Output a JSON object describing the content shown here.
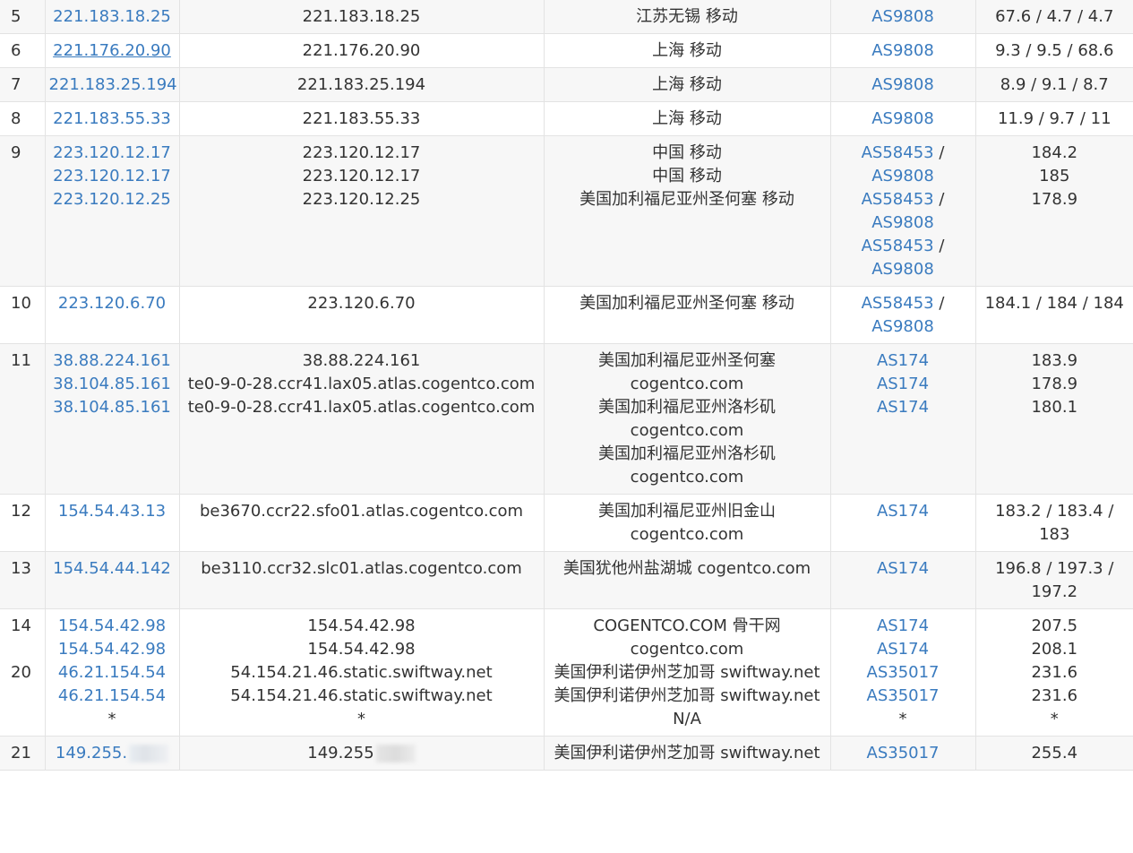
{
  "rows": [
    {
      "hop": "5",
      "ips": [
        "221.183.18.25"
      ],
      "hosts": [
        "221.183.18.25"
      ],
      "locs": [
        "江苏无锡 移动"
      ],
      "as": [
        [
          "AS9808"
        ]
      ],
      "rtt": [
        "67.6 / 4.7 / 4.7"
      ]
    },
    {
      "hop": "6",
      "ips": [
        "221.176.20.90"
      ],
      "hosts": [
        "221.176.20.90"
      ],
      "locs": [
        "上海 移动"
      ],
      "as": [
        [
          "AS9808"
        ]
      ],
      "rtt": [
        "9.3 / 9.5 / 68.6"
      ]
    },
    {
      "hop": "7",
      "ips": [
        "221.183.25.194"
      ],
      "hosts": [
        "221.183.25.194"
      ],
      "locs": [
        "上海 移动"
      ],
      "as": [
        [
          "AS9808"
        ]
      ],
      "rtt": [
        "8.9 / 9.1 / 8.7"
      ]
    },
    {
      "hop": "8",
      "ips": [
        "221.183.55.33"
      ],
      "hosts": [
        "221.183.55.33"
      ],
      "locs": [
        "上海 移动"
      ],
      "as": [
        [
          "AS9808"
        ]
      ],
      "rtt": [
        "11.9 / 9.7 / 11"
      ]
    },
    {
      "hop": "9",
      "ips": [
        "223.120.12.17",
        "223.120.12.17",
        "223.120.12.25"
      ],
      "hosts": [
        "223.120.12.17",
        "223.120.12.17",
        "223.120.12.25"
      ],
      "locs": [
        "中国 移动",
        "中国 移动",
        "美国加利福尼亚州圣何塞 移动"
      ],
      "as": [
        [
          "AS58453",
          "AS9808"
        ],
        [
          "AS58453",
          "AS9808"
        ],
        [
          "AS58453",
          "AS9808"
        ]
      ],
      "rtt": [
        "184.2",
        "185",
        "178.9"
      ]
    },
    {
      "hop": "10",
      "ips": [
        "223.120.6.70"
      ],
      "hosts": [
        "223.120.6.70"
      ],
      "locs": [
        "美国加利福尼亚州圣何塞 移动"
      ],
      "as": [
        [
          "AS58453",
          "AS9808"
        ]
      ],
      "rtt": [
        "184.1 / 184 / 184"
      ]
    },
    {
      "hop": "11",
      "ips": [
        "38.88.224.161",
        "38.104.85.161",
        "38.104.85.161"
      ],
      "hosts": [
        "38.88.224.161",
        "te0-9-0-28.ccr41.lax05.atlas.cogentco.com",
        "te0-9-0-28.ccr41.lax05.atlas.cogentco.com"
      ],
      "locs": [
        "美国加利福尼亚州圣何塞",
        "cogentco.com",
        "美国加利福尼亚州洛杉矶",
        "cogentco.com",
        "美国加利福尼亚州洛杉矶",
        "cogentco.com"
      ],
      "as": [
        [
          "AS174"
        ],
        [
          "AS174"
        ],
        [
          "AS174"
        ]
      ],
      "rtt": [
        "183.9",
        "178.9",
        "180.1"
      ]
    },
    {
      "hop": "12",
      "ips": [
        "154.54.43.13"
      ],
      "hosts": [
        "be3670.ccr22.sfo01.atlas.cogentco.com"
      ],
      "locs": [
        "美国加利福尼亚州旧金山",
        "cogentco.com"
      ],
      "as": [
        [
          "AS174"
        ]
      ],
      "rtt": [
        "183.2 / 183.4 /",
        "183"
      ]
    },
    {
      "hop": "13",
      "ips": [
        "154.54.44.142"
      ],
      "hosts": [
        "be3110.ccr32.slc01.atlas.cogentco.com"
      ],
      "locs": [
        "美国犹他州盐湖城 cogentco.com"
      ],
      "as": [
        [
          "AS174"
        ]
      ],
      "rtt": [
        "196.8 / 197.3 /",
        "197.2"
      ]
    },
    {
      "hop": "14",
      "ips": [
        "154.54.42.98",
        "154.54.42.98"
      ],
      "hosts": [
        "154.54.42.98",
        "154.54.42.98"
      ],
      "locs": [
        "COGENTCO.COM 骨干网",
        "cogentco.com"
      ],
      "as": [
        [
          "AS174"
        ],
        [
          "AS174"
        ]
      ],
      "rtt": [
        "207.5",
        "208.1"
      ]
    },
    {
      "hop": "20",
      "ips": [
        "46.21.154.54",
        "46.21.154.54",
        "*"
      ],
      "hosts": [
        "54.154.21.46.static.swiftway.net",
        "54.154.21.46.static.swiftway.net",
        "*"
      ],
      "locs": [
        "美国伊利诺伊州芝加哥 swiftway.net",
        "美国伊利诺伊州芝加哥 swiftway.net",
        "N/A"
      ],
      "as": [
        [
          "AS35017"
        ],
        [
          "AS35017"
        ],
        [
          "*"
        ]
      ],
      "rtt": [
        "231.6",
        "231.6",
        "*"
      ]
    },
    {
      "hop": "21",
      "ips": [
        "149.255."
      ],
      "hosts": [
        "149.255"
      ],
      "locs": [
        "美国伊利诺伊州芝加哥 swiftway.net"
      ],
      "as": [
        [
          "AS35017"
        ]
      ],
      "rtt": [
        "255.4"
      ]
    }
  ]
}
